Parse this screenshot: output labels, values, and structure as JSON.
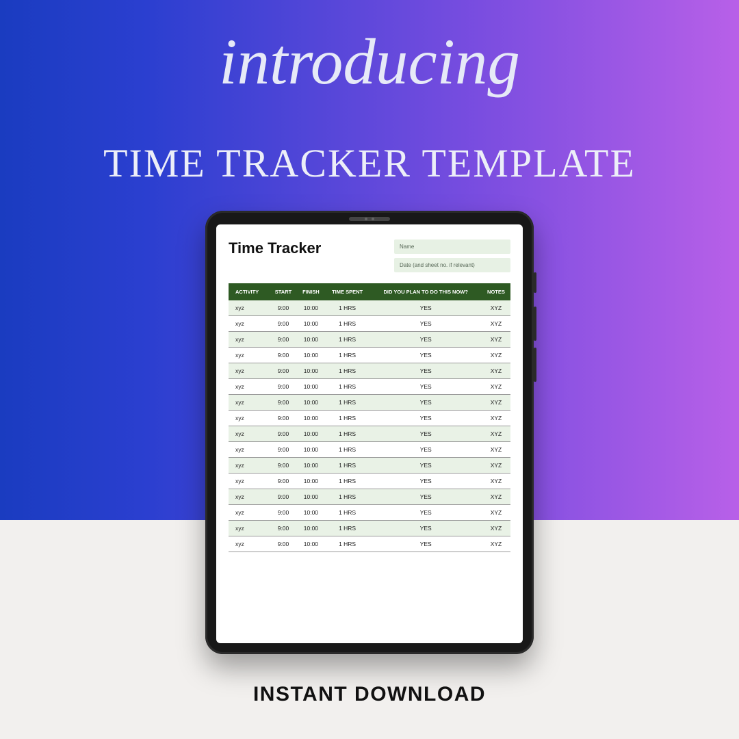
{
  "hero": {
    "script_text": "introducing",
    "headline": "TIME TRACKER TEMPLATE",
    "footer": "INSTANT DOWNLOAD"
  },
  "doc": {
    "title": "Time Tracker",
    "field_name": "Name",
    "field_date": "Date (and sheet no. if relevant)"
  },
  "table": {
    "headers": {
      "activity": "ACTIVITY",
      "start": "START",
      "finish": "FINISH",
      "time_spent": "TIME SPENT",
      "plan": "DID YOU PLAN TO DO THIS NOW?",
      "notes": "NOTES"
    },
    "rows": [
      {
        "activity": "xyz",
        "start": "9:00",
        "finish": "10:00",
        "time_spent": "1 HRS",
        "plan": "YES",
        "notes": "XYZ"
      },
      {
        "activity": "xyz",
        "start": "9:00",
        "finish": "10:00",
        "time_spent": "1 HRS",
        "plan": "YES",
        "notes": "XYZ"
      },
      {
        "activity": "xyz",
        "start": "9:00",
        "finish": "10:00",
        "time_spent": "1 HRS",
        "plan": "YES",
        "notes": "XYZ"
      },
      {
        "activity": "xyz",
        "start": "9:00",
        "finish": "10:00",
        "time_spent": "1 HRS",
        "plan": "YES",
        "notes": "XYZ"
      },
      {
        "activity": "xyz",
        "start": "9:00",
        "finish": "10:00",
        "time_spent": "1 HRS",
        "plan": "YES",
        "notes": "XYZ"
      },
      {
        "activity": "xyz",
        "start": "9:00",
        "finish": "10:00",
        "time_spent": "1 HRS",
        "plan": "YES",
        "notes": "XYZ"
      },
      {
        "activity": "xyz",
        "start": "9:00",
        "finish": "10:00",
        "time_spent": "1 HRS",
        "plan": "YES",
        "notes": "XYZ"
      },
      {
        "activity": "xyz",
        "start": "9:00",
        "finish": "10:00",
        "time_spent": "1 HRS",
        "plan": "YES",
        "notes": "XYZ"
      },
      {
        "activity": "xyz",
        "start": "9:00",
        "finish": "10:00",
        "time_spent": "1 HRS",
        "plan": "YES",
        "notes": "XYZ"
      },
      {
        "activity": "xyz",
        "start": "9:00",
        "finish": "10:00",
        "time_spent": "1 HRS",
        "plan": "YES",
        "notes": "XYZ"
      },
      {
        "activity": "xyz",
        "start": "9:00",
        "finish": "10:00",
        "time_spent": "1 HRS",
        "plan": "YES",
        "notes": "XYZ"
      },
      {
        "activity": "xyz",
        "start": "9:00",
        "finish": "10:00",
        "time_spent": "1 HRS",
        "plan": "YES",
        "notes": "XYZ"
      },
      {
        "activity": "xyz",
        "start": "9:00",
        "finish": "10:00",
        "time_spent": "1 HRS",
        "plan": "YES",
        "notes": "XYZ"
      },
      {
        "activity": "xyz",
        "start": "9:00",
        "finish": "10:00",
        "time_spent": "1 HRS",
        "plan": "YES",
        "notes": "XYZ"
      },
      {
        "activity": "xyz",
        "start": "9:00",
        "finish": "10:00",
        "time_spent": "1 HRS",
        "plan": "YES",
        "notes": "XYZ"
      },
      {
        "activity": "xyz",
        "start": "9:00",
        "finish": "10:00",
        "time_spent": "1 HRS",
        "plan": "YES",
        "notes": "XYZ"
      }
    ]
  }
}
